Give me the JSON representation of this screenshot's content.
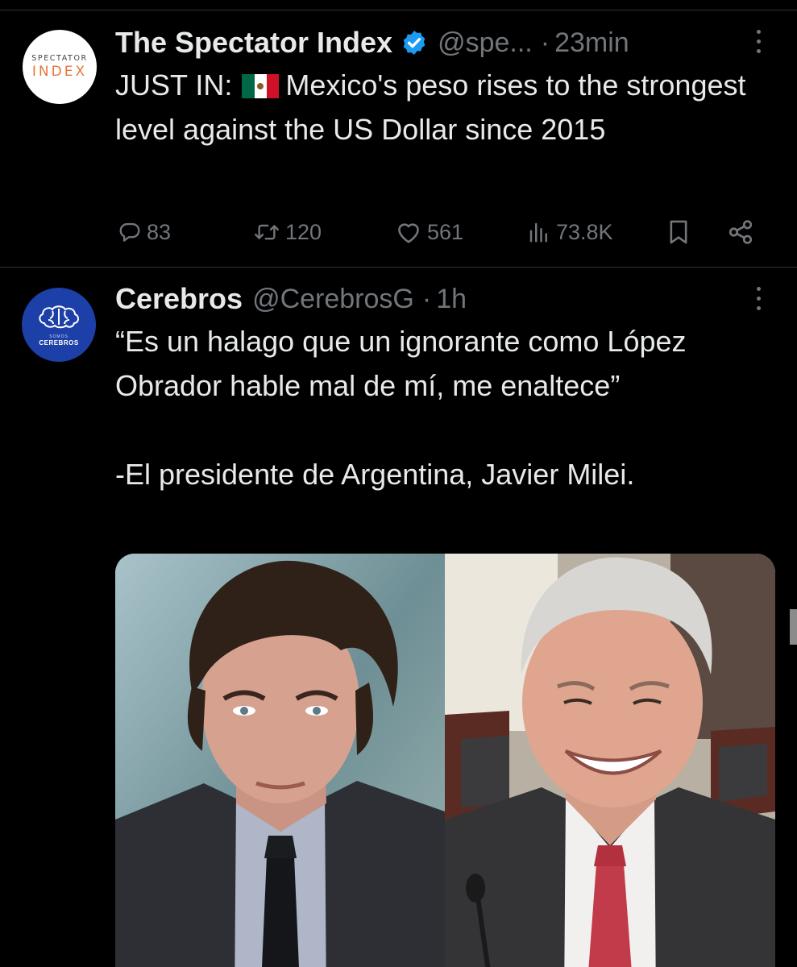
{
  "tweets": [
    {
      "author": {
        "display_name": "The Spectator Index",
        "handle": "@spe...",
        "verified": true,
        "avatar": {
          "line1": "SPECTATOR",
          "line2": "INDEX"
        }
      },
      "separator": "·",
      "time": "23min",
      "text_before_flag": "JUST IN: ",
      "flag_icon": "mexico-flag",
      "text_after_flag": "Mexico's peso rises to the strongest level against the US Dollar since 2015",
      "metrics": {
        "replies": "83",
        "retweets": "120",
        "likes": "561",
        "views": "73.8K"
      }
    },
    {
      "author": {
        "display_name": "Cerebros",
        "handle": "@CerebrosG",
        "verified": false,
        "avatar": {
          "line1": "SOMOS",
          "line2": "CEREBROS"
        }
      },
      "separator": "·",
      "time": "1h",
      "text": "“Es un halago que un ignorante como López Obrador hable mal de mí, me enaltece”\n\n-El presidente de Argentina, Javier Milei.",
      "media": [
        "photo-javier-milei",
        "photo-lopez-obrador"
      ]
    }
  ],
  "colors": {
    "background": "#000000",
    "text_primary": "#e7e9ea",
    "text_secondary": "#71767b",
    "divider": "#2f3336",
    "verified_badge": "#1d9bf0",
    "cerebros_avatar": "#1d3fa8",
    "spectator_accent": "#e8753a"
  }
}
